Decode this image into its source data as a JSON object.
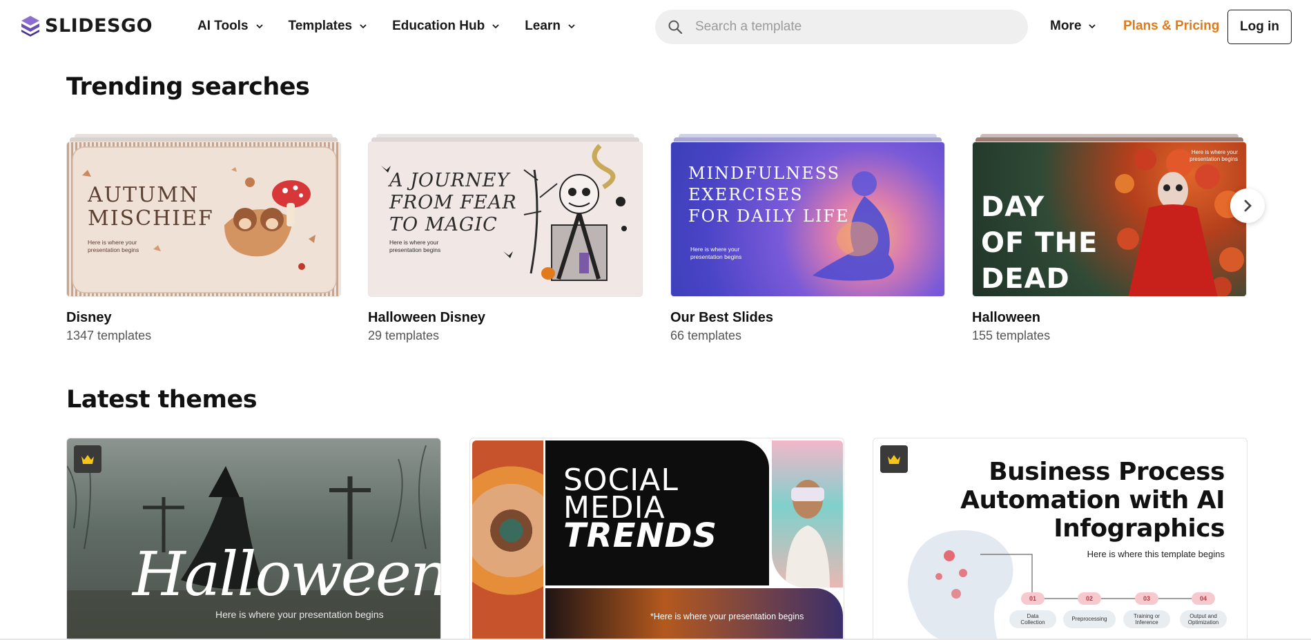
{
  "header": {
    "logo_text": "SLIDESGO",
    "nav": [
      {
        "label": "AI Tools"
      },
      {
        "label": "Templates"
      },
      {
        "label": "Education Hub"
      },
      {
        "label": "Learn"
      }
    ],
    "search_placeholder": "Search a template",
    "more_label": "More",
    "pricing_label": "Plans & Pricing",
    "login_label": "Log in"
  },
  "trending": {
    "title": "Trending searches",
    "items": [
      {
        "name": "Disney",
        "count": "1347 templates",
        "thumb": {
          "title_line1": "AUTUMN",
          "title_line2": "MISCHIEF",
          "sub_line1": "Here is where your",
          "sub_line2": "presentation begins"
        }
      },
      {
        "name": "Halloween Disney",
        "count": "29 templates",
        "thumb": {
          "title_line1": "A JOURNEY",
          "title_line2": "FROM FEAR",
          "title_line3": "TO MAGIC",
          "sub_line1": "Here is where your",
          "sub_line2": "presentation begins"
        }
      },
      {
        "name": "Our Best Slides",
        "count": "66 templates",
        "thumb": {
          "title_line1": "MINDFULNESS",
          "title_line2": "EXERCISES",
          "title_line3": "FOR DAILY LIFE",
          "sub_line1": "Here is where your",
          "sub_line2": "presentation begins"
        }
      },
      {
        "name": "Halloween",
        "count": "155 templates",
        "thumb": {
          "title_line1": "DAY",
          "title_line2": "OF THE",
          "title_line3": "DEAD",
          "sub_line1": "Here is where your",
          "sub_line2": "presentation begins"
        }
      }
    ]
  },
  "latest": {
    "title": "Latest themes",
    "items": [
      {
        "thumb": {
          "title": "Halloween",
          "sub": "Here is where your presentation begins"
        },
        "premium": true
      },
      {
        "thumb": {
          "line1": "SOCIAL",
          "line2": "MEDIA",
          "line3": "TRENDS",
          "sub": "*Here is where your presentation begins"
        },
        "premium": false
      },
      {
        "thumb": {
          "line1": "Business Process",
          "line2": "Automation with AI",
          "line3": "Infographics",
          "sub": "Here is where this template begins",
          "steps": [
            {
              "num": "01",
              "label_line1": "Data",
              "label_line2": "Collection"
            },
            {
              "num": "02",
              "label_line1": "Preprocessing",
              "label_line2": ""
            },
            {
              "num": "03",
              "label_line1": "Training or",
              "label_line2": "Inference"
            },
            {
              "num": "04",
              "label_line1": "Output and",
              "label_line2": "Optimization"
            }
          ]
        },
        "premium": true
      }
    ]
  },
  "colors": {
    "accent": "#e07a1b",
    "logo": "#6a4fb0",
    "search_bg": "#efefef",
    "crown_bg": "#3a3a3a",
    "crown": "#f5c518"
  }
}
